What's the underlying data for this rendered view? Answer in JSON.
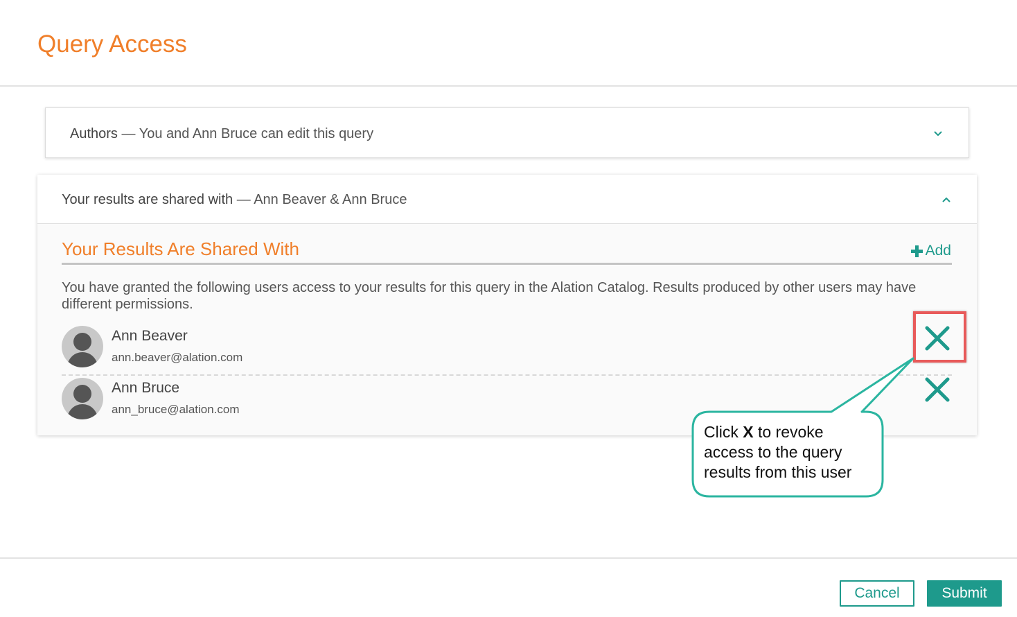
{
  "dialog": {
    "title": "Query Access"
  },
  "authors": {
    "label": "Authors",
    "separator": " — ",
    "summary": "You and Ann Bruce can edit this query",
    "chevron_icon": "chevron-down-icon"
  },
  "shared": {
    "label": "Your results are shared with",
    "separator": " — ",
    "summary": "Ann Beaver & Ann Bruce",
    "chevron_icon": "chevron-up-icon",
    "section_title": "Your Results Are Shared With",
    "add_label": "Add",
    "description": "You have granted the following users access to your results for this query in the Alation Catalog. Results produced by other users may have different permissions.",
    "users": [
      {
        "name": "Ann Beaver",
        "email": "ann.beaver@alation.com"
      },
      {
        "name": "Ann Bruce",
        "email": "ann_bruce@alation.com"
      }
    ]
  },
  "callout": {
    "prefix": "Click ",
    "bold": "X",
    "suffix": " to revoke access to the query results from this user",
    "border_color": "#2bb5a0",
    "highlight_color": "#e85a5a"
  },
  "footer": {
    "cancel_label": "Cancel",
    "submit_label": "Submit"
  },
  "colors": {
    "accent": "#f07f2a",
    "teal": "#1e9a8c"
  }
}
